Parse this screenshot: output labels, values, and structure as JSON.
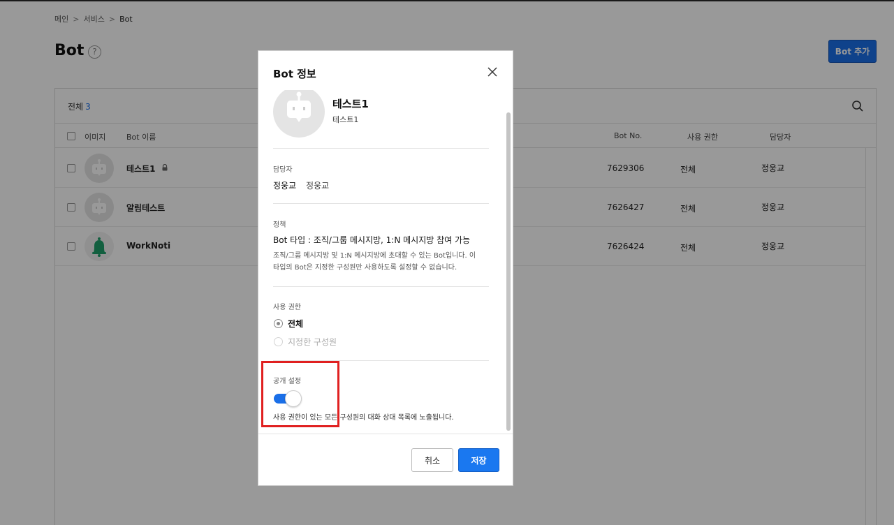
{
  "breadcrumb": {
    "items": [
      "메인",
      "서비스",
      "Bot"
    ],
    "separator": ">"
  },
  "page": {
    "title": "Bot",
    "help_icon": "?",
    "add_button": "Bot 추가"
  },
  "list": {
    "count_label": "전체",
    "count": "3",
    "headers": {
      "image": "이미지",
      "name": "Bot 이름",
      "bot_no": "Bot No.",
      "permission": "사용 권한",
      "owner": "담당자"
    },
    "rows": [
      {
        "name": "테스트1",
        "locked": true,
        "bot_no": "7629306",
        "permission": "전체",
        "owner": "정웅교",
        "icon": "robot-icon"
      },
      {
        "name": "알림테스트",
        "locked": false,
        "bot_no": "7626427",
        "permission": "전체",
        "owner": "정웅교",
        "icon": "robot-icon"
      },
      {
        "name": "WorkNoti",
        "locked": false,
        "bot_no": "7626424",
        "permission": "전체",
        "owner": "정웅교",
        "icon": "bell-icon"
      }
    ]
  },
  "modal": {
    "title": "Bot 정보",
    "bot_name": "테스트1",
    "bot_description": "테스트1",
    "owner_label": "담당자",
    "owner_main": "정웅교",
    "owner_sub": "정웅교",
    "policy_label": "정책",
    "policy_title": "Bot 타입 : 조직/그룹 메시지방, 1:N 메시지방 참여 가능",
    "policy_desc_line1": "조직/그룹 메시지방 및 1:N 메시지방에 초대할 수 있는 Bot입니다. 이",
    "policy_desc_line2": "타입의 Bot은 지정한 구성원만 사용하도록 설정할 수 없습니다.",
    "permission_label": "사용 권한",
    "permission_options": [
      {
        "label": "전체",
        "checked": true
      },
      {
        "label": "지정한 구성원",
        "checked": false,
        "disabled": true
      }
    ],
    "public_label": "공개 설정",
    "public_enabled": true,
    "public_desc": "사용 권한이 있는 모든 구성원의 대화 상대 목록에 노출됩니다.",
    "cancel_label": "취소",
    "save_label": "저장"
  },
  "colors": {
    "accent": "#1a6fe8",
    "highlight": "#e02020"
  }
}
